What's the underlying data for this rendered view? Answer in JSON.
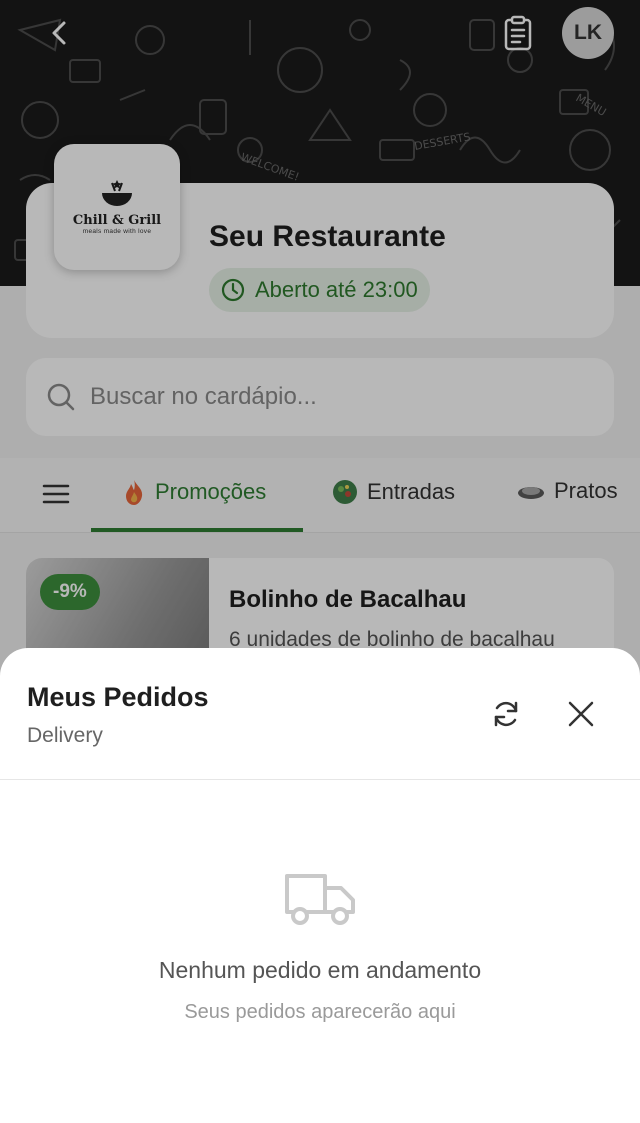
{
  "header": {
    "back_icon": "chevron-left-icon",
    "orders_icon": "clipboard-icon",
    "avatar_initials": "LK"
  },
  "restaurant": {
    "logo_name": "Chill & Grill",
    "logo_tagline": "meals made with love",
    "name": "Seu Restaurante",
    "status": "Aberto até 23:00",
    "status_color": "#2f7a2f"
  },
  "search": {
    "placeholder": "Buscar no cardápio..."
  },
  "tabs": [
    {
      "label": "Promoções",
      "icon": "fire-icon",
      "active": true
    },
    {
      "label": "Entradas",
      "icon": "salad-icon",
      "active": false
    },
    {
      "label": "Pratos",
      "icon": "plate-icon",
      "active": false
    }
  ],
  "product": {
    "discount": "-9%",
    "title": "Bolinho de Bacalhau",
    "description": "6 unidades de bolinho de bacalhau"
  },
  "orders_sheet": {
    "title": "Meus Pedidos",
    "subtitle": "Delivery",
    "empty_title": "Nenhum pedido em andamento",
    "empty_subtitle": "Seus pedidos aparecerão aqui"
  },
  "colors": {
    "accent": "#2e7d32",
    "badge": "#3d8f3d"
  }
}
